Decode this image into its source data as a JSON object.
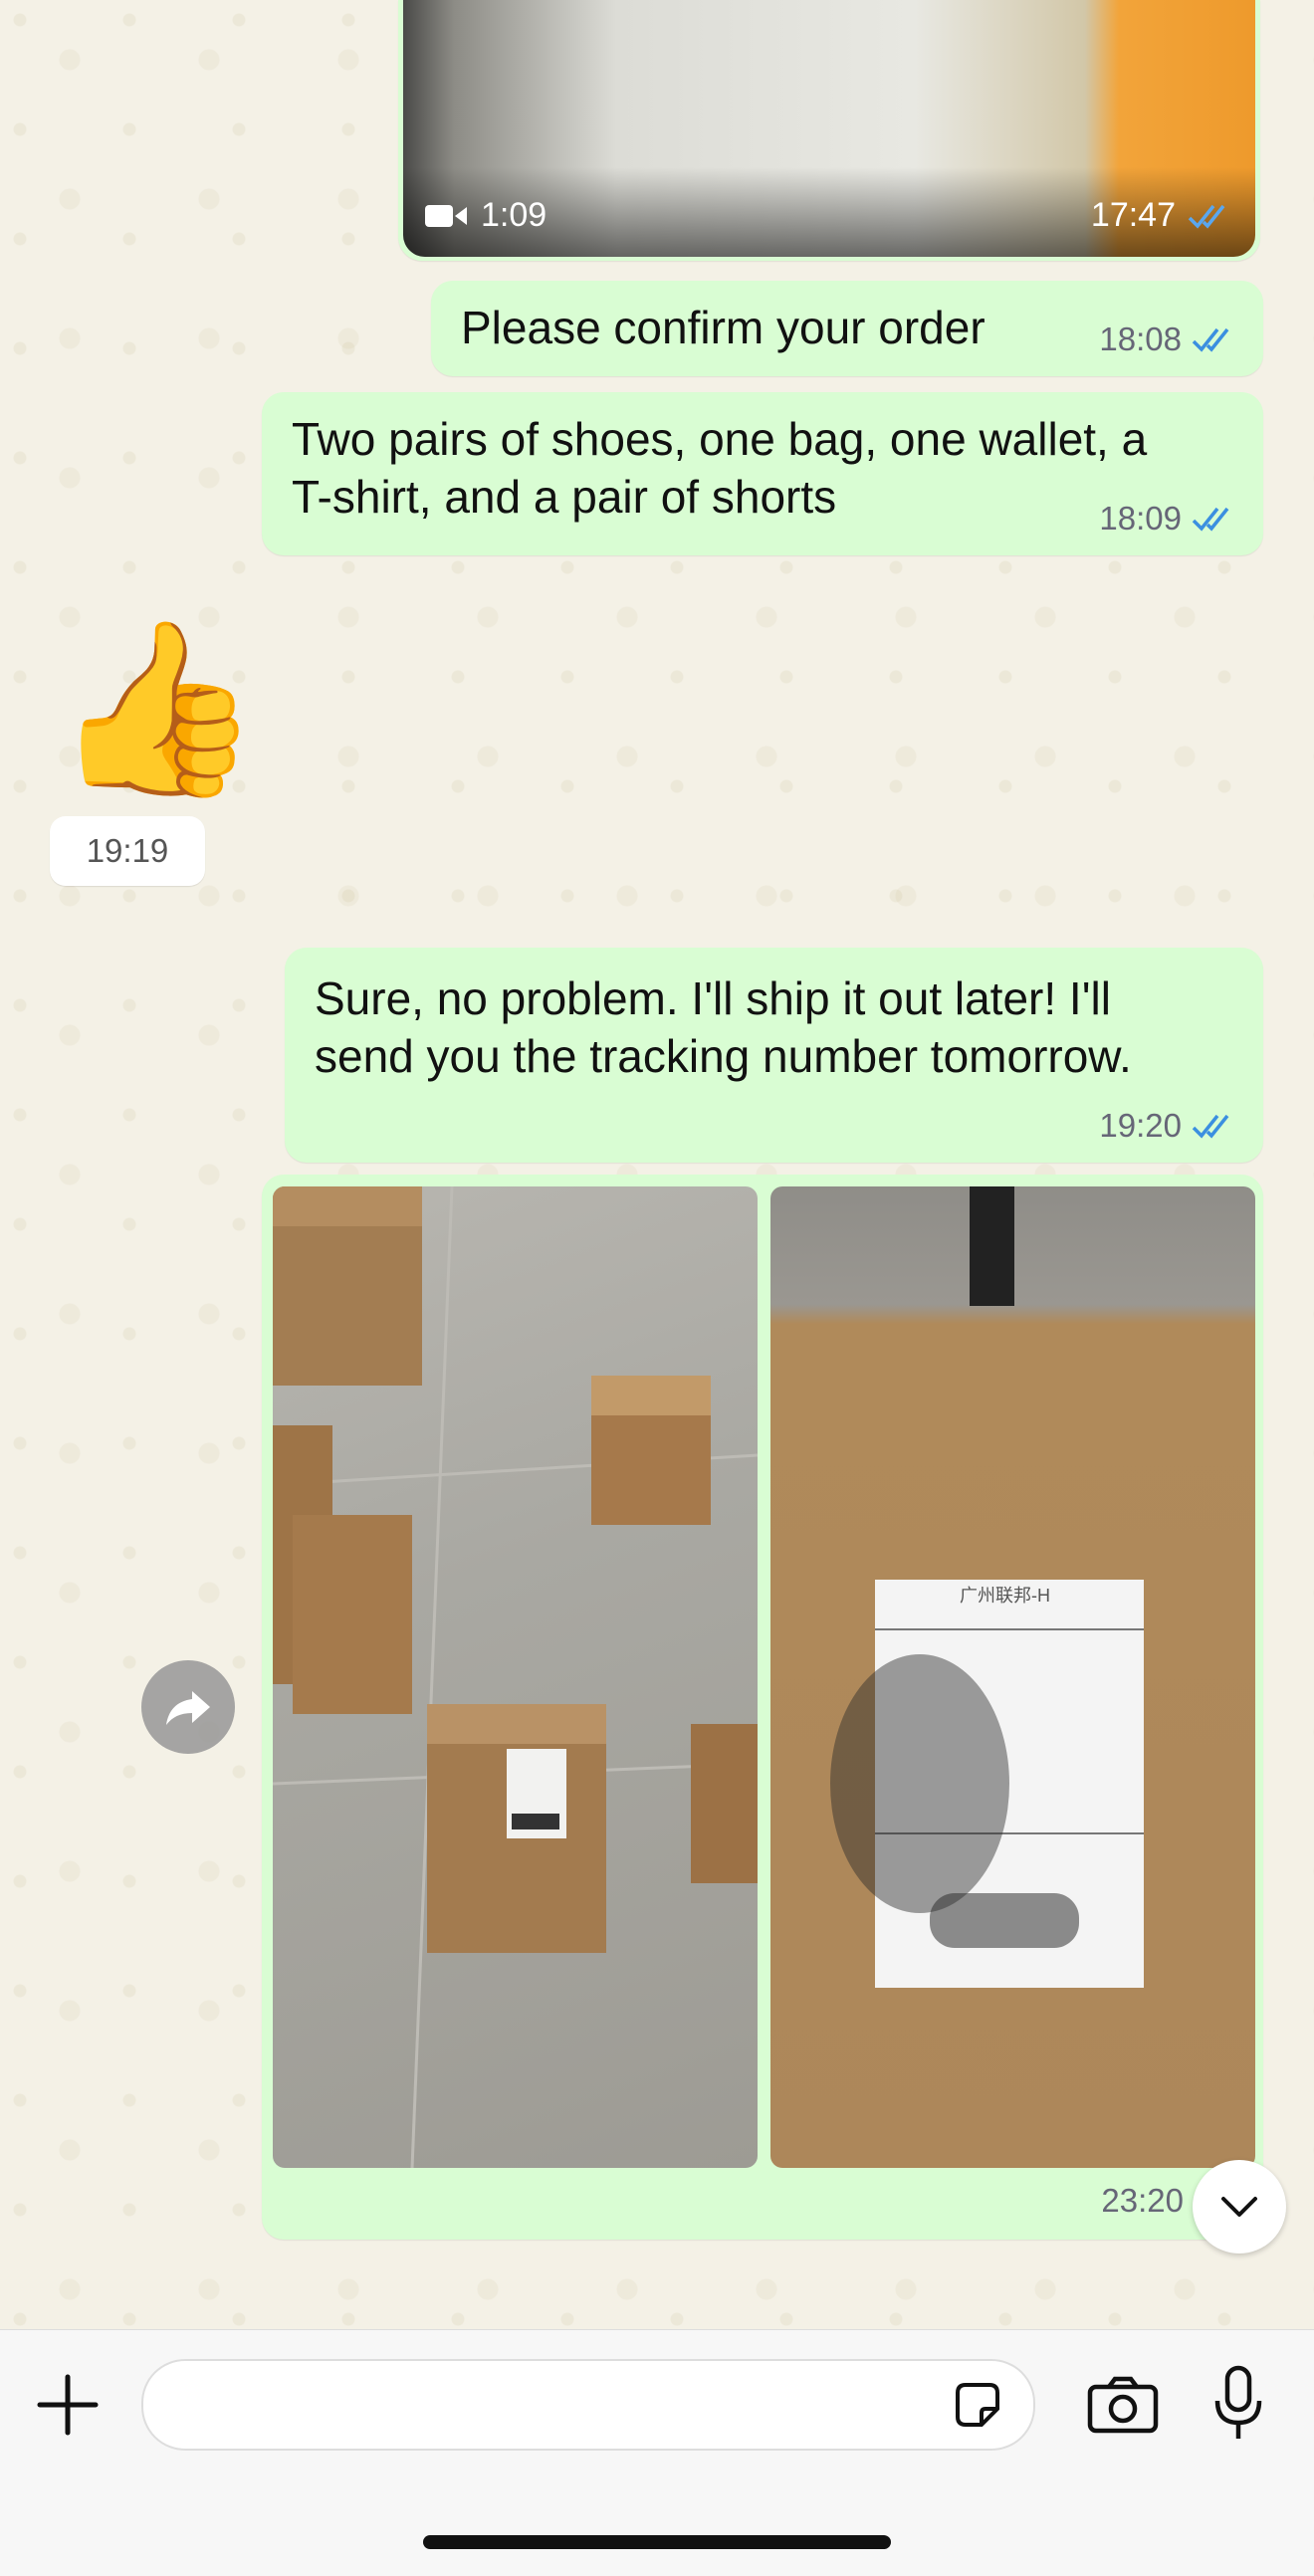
{
  "messages": {
    "video": {
      "duration": "1:09",
      "time": "17:47"
    },
    "msg1": {
      "text": "Please confirm your order",
      "time": "18:08"
    },
    "msg2": {
      "line1": "Two pairs of shoes, one bag, one wallet, a",
      "line2": "T-shirt, and a pair of shorts",
      "time": "18:09"
    },
    "reaction": {
      "emoji": "👍",
      "time": "19:19"
    },
    "msg3": {
      "line1": "Sure, no problem. I'll ship it out later! I'll",
      "line2": "send you the tracking number tomorrow.",
      "time": "19:20"
    },
    "photos": {
      "label_text": "广州联邦-H",
      "time": "23:20"
    }
  },
  "colors": {
    "outgoing_bubble": "#d9fdd3",
    "read_ticks": "#3b8fe0",
    "chat_background": "#f4f1e6"
  },
  "icons": [
    "video-camera-icon",
    "double-check-icon",
    "forward-icon",
    "chevron-down-icon",
    "plus-icon",
    "sticker-icon",
    "camera-icon",
    "microphone-icon"
  ]
}
